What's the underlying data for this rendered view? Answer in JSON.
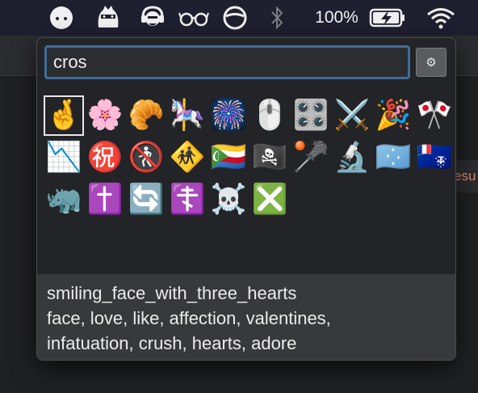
{
  "menubar": {
    "battery_percent": "100%",
    "icons": [
      "finder-face-icon",
      "ninja-cat-icon",
      "monitor-person-icon",
      "glasses-icon",
      "circle-slash-icon",
      "bluetooth-icon",
      "battery-charging-icon",
      "wifi-icon"
    ]
  },
  "background": {
    "fragment_text": "esu"
  },
  "emoji_picker": {
    "search_value": "cros",
    "settings_icon": "gear-icon",
    "emojis": [
      "🤞",
      "🌸",
      "🥐",
      "🎠",
      "🎆",
      "🖱️",
      "🎛️",
      "⚔️",
      "🎉",
      "🎌",
      "📉",
      "㊗️",
      "🚷",
      "🚸",
      "🇰🇲",
      "🏴‍☠️",
      "🥍",
      "🔬",
      "🇫🇲",
      "🇹🇫",
      "🦏",
      "✝️",
      "🔄",
      "☦️",
      "☠️",
      "❎"
    ],
    "selected_index": 0,
    "detail": {
      "name": "smiling_face_with_three_hearts",
      "keywords_line1": "face, love, like, affection, valentines,",
      "keywords_line2": "infatuation, crush, hearts, adore"
    }
  }
}
